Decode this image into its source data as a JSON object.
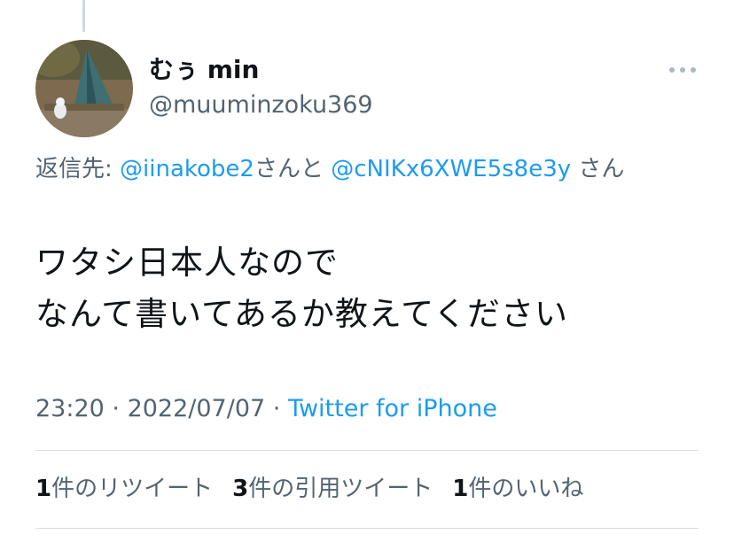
{
  "tweet": {
    "display_name": "むぅ min",
    "username": "@muuminzoku369",
    "reply_to": {
      "prefix": "返信先: ",
      "mention1": "@iinakobe2",
      "joiner": "さんと",
      "mention2": "@cNIKx6XWE5s8e3y",
      "suffix": "さん"
    },
    "text": "ワタシ日本人なので\nなんて書いてあるか教えてください",
    "time": "23:20",
    "separator": " · ",
    "date": "2022/07/07",
    "source": "Twitter for iPhone"
  },
  "stats": {
    "retweets_count": "1",
    "retweets_label": "件のリツイート",
    "quotes_count": "3",
    "quotes_label": "件の引用ツイート",
    "likes_count": "1",
    "likes_label": "件のいいね"
  },
  "icons": {
    "more": "more-horizontal-icon",
    "avatar": "avatar-photo"
  },
  "colors": {
    "link": "#1d9bf0",
    "secondary_text": "#536471",
    "primary_text": "#0f1419"
  }
}
